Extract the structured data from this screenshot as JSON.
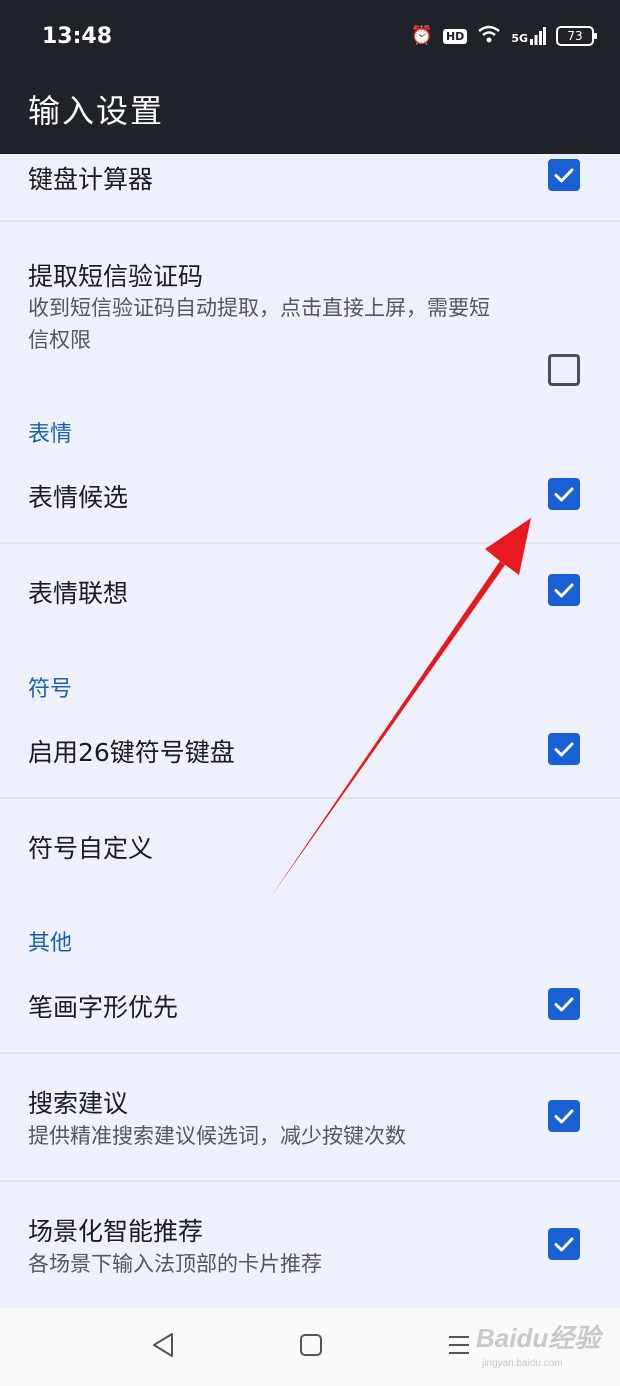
{
  "status_bar": {
    "time": "13:48",
    "hd_label": "HD",
    "signal_label": "5G",
    "battery": "73"
  },
  "header": {
    "title": "输入设置"
  },
  "colors": {
    "accent": "#1a5fd4",
    "section": "#1a5fb4",
    "header_bg": "#1f2329",
    "arrow": "#e8191e"
  },
  "settings": {
    "keyboard_calculator": {
      "title": "键盘计算器",
      "checked": true
    },
    "sms_code": {
      "title": "提取短信验证码",
      "subtitle": "收到短信验证码自动提取，点击直接上屏，需要短信权限",
      "checked": false
    },
    "section_emoji": "表情",
    "emoji_candidate": {
      "title": "表情候选",
      "checked": true
    },
    "emoji_association": {
      "title": "表情联想",
      "checked": true
    },
    "section_symbol": "符号",
    "symbol_26key": {
      "title": "启用26键符号键盘",
      "checked": true
    },
    "symbol_custom": {
      "title": "符号自定义"
    },
    "section_other": "其他",
    "stroke_priority": {
      "title": "笔画字形优先",
      "checked": true
    },
    "search_suggest": {
      "title": "搜索建议",
      "subtitle": "提供精准搜索建议候选词，减少按键次数",
      "checked": true
    },
    "scene_recommend": {
      "title": "场景化智能推荐",
      "subtitle": "各场景下输入法顶部的卡片推荐",
      "checked": true
    }
  },
  "nav_bar": {
    "icons": [
      "back-icon",
      "home-icon",
      "menu-icon"
    ]
  },
  "watermark": {
    "main": "Baidu经验",
    "sub": "jingyan.baidu.com"
  }
}
